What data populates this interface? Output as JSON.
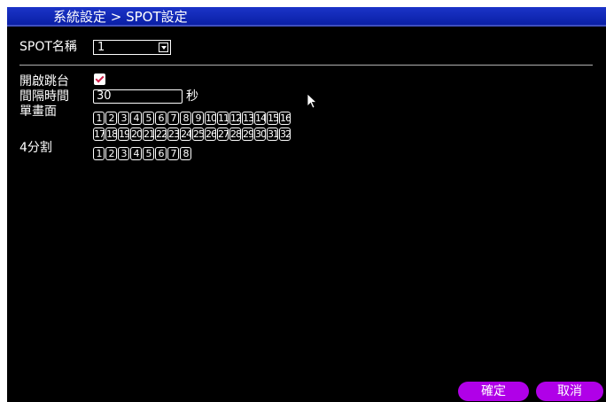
{
  "header": {
    "title": "系統設定 > SPOT設定"
  },
  "spot": {
    "name_label": "SPOT名稱",
    "name_value": "1"
  },
  "settings": {
    "jump_label": "開啟跳台",
    "jump_checked": true,
    "interval_label": "間隔時間",
    "interval_value": "30",
    "interval_unit": "秒",
    "single_label": "單畫面",
    "quad_label": "4分割"
  },
  "single_channels_row1": [
    "1",
    "2",
    "3",
    "4",
    "5",
    "6",
    "7",
    "8",
    "9",
    "10",
    "11",
    "12",
    "13",
    "14",
    "15",
    "16"
  ],
  "single_channels_row2": [
    "17",
    "18",
    "19",
    "20",
    "21",
    "22",
    "23",
    "24",
    "25",
    "26",
    "27",
    "28",
    "29",
    "30",
    "31",
    "32"
  ],
  "quad_channels": [
    "1",
    "2",
    "3",
    "4",
    "5",
    "6",
    "7",
    "8"
  ],
  "buttons": {
    "ok": "確定",
    "cancel": "取消"
  },
  "colors": {
    "title_bar": "#0a1fa6",
    "button": "#b000e8",
    "background": "#000000",
    "check": "#d0204a"
  },
  "icons": {
    "combo": "chevron-down-icon",
    "checkbox": "check-icon",
    "cursor": "cursor-arrow-icon"
  }
}
